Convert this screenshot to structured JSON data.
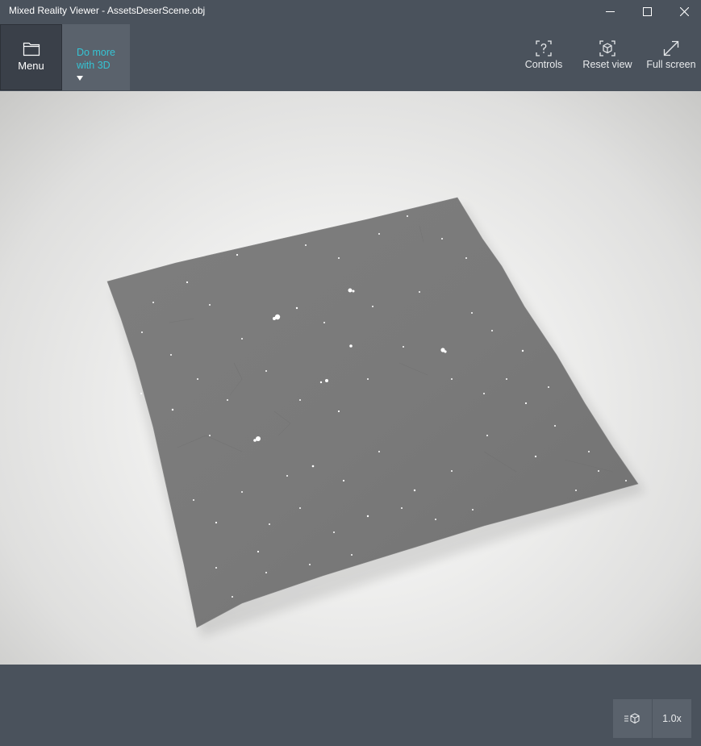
{
  "window": {
    "title": "Mixed Reality Viewer - AssetsDeserScene.obj",
    "minimize_icon": "minimize-icon",
    "maximize_icon": "maximize-icon",
    "close_icon": "close-icon"
  },
  "toolbar": {
    "menu_label": "Menu",
    "menu_icon": "folder-icon",
    "do_more_line1": "Do more",
    "do_more_line2": "with 3D",
    "do_more_color": "#35c4d4",
    "controls_label": "Controls",
    "controls_icon": "help-frame-icon",
    "reset_view_label": "Reset view",
    "reset_view_icon": "cube-frame-icon",
    "full_screen_label": "Full screen",
    "full_screen_icon": "expand-arrow-icon"
  },
  "viewport": {
    "model_color": "#7b7b7b"
  },
  "bottom": {
    "animation_icon": "animation-cube-icon",
    "speed_label": "1.0x"
  }
}
